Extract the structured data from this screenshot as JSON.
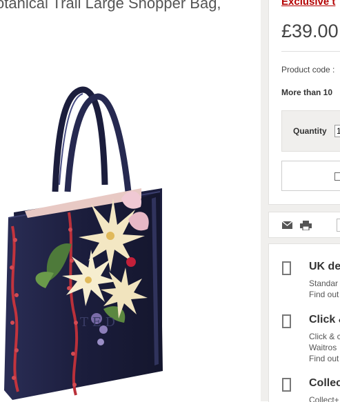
{
  "product": {
    "title": "otanical Trail Large Shopper Bag,"
  },
  "purchase": {
    "exclusive_label": "Exclusive t",
    "price": "£39.00",
    "product_code_label": "Product code :",
    "stock_text": "More than 10",
    "quantity_label": "Quantity",
    "quantity_value": "1"
  },
  "share": {
    "icons": [
      "mail-icon",
      "print-icon",
      "share-icon"
    ]
  },
  "delivery": {
    "items": [
      {
        "title": "UK de",
        "lines": [
          "Standar",
          "Find out"
        ]
      },
      {
        "title": "Click &",
        "lines": [
          "Click & c",
          "Waitros",
          "Find out"
        ]
      },
      {
        "title": "Collec",
        "lines": [
          "Collect+"
        ]
      }
    ]
  },
  "colors": {
    "exclusive_red": "#b40000",
    "bag_navy": "#1b1d3c",
    "panel_background": "#f0efed"
  }
}
